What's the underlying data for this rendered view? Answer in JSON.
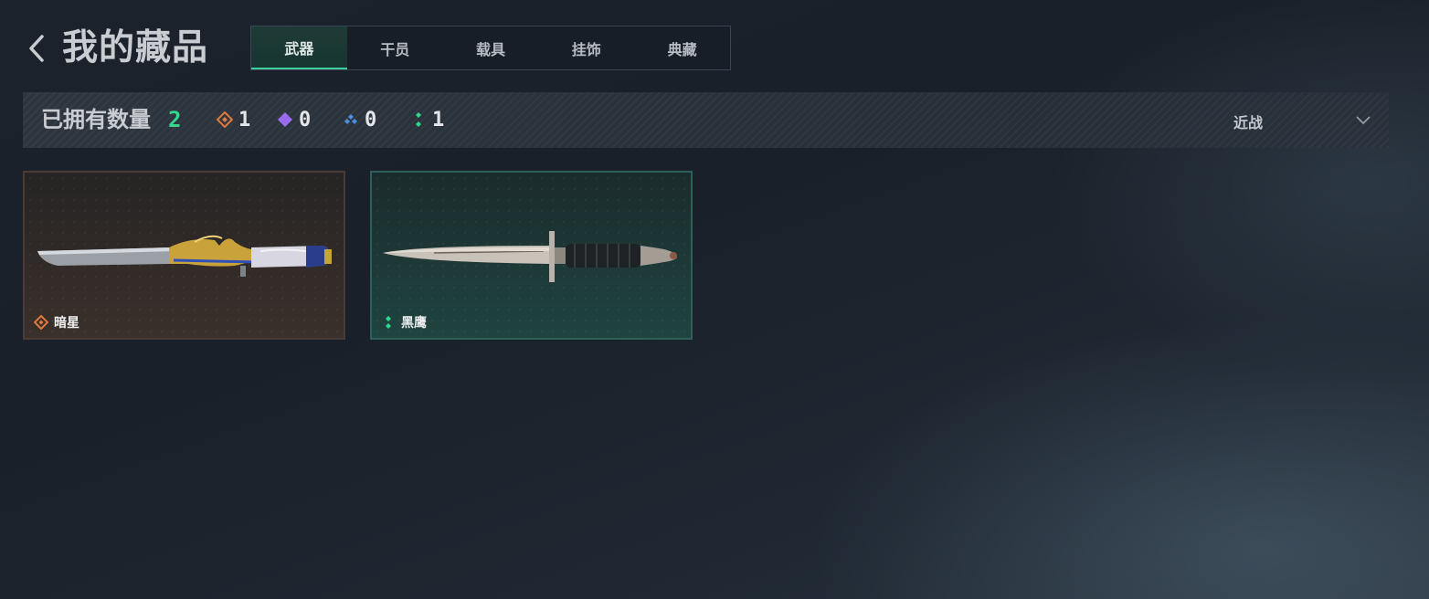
{
  "header": {
    "title": "我的藏品"
  },
  "tabs": [
    {
      "label": "武器",
      "active": true
    },
    {
      "label": "干员",
      "active": false
    },
    {
      "label": "载具",
      "active": false
    },
    {
      "label": "挂饰",
      "active": false
    },
    {
      "label": "典藏",
      "active": false
    }
  ],
  "summary": {
    "label": "已拥有数量",
    "total": "2",
    "rarities": [
      {
        "icon": "orange-diamond-icon",
        "color": "#e07a3c",
        "count": "1"
      },
      {
        "icon": "purple-diamond-icon",
        "color": "#9b6cf0",
        "count": "0"
      },
      {
        "icon": "blue-diamond-icon",
        "color": "#4a8fe0",
        "count": "0"
      },
      {
        "icon": "green-dots-icon",
        "color": "#35d58f",
        "count": "1"
      }
    ],
    "filter": {
      "selected": "近战",
      "icon": "chevron-down-icon"
    }
  },
  "items": [
    {
      "name": "暗星",
      "rarity_color": "#e07a3c",
      "rarity_icon": "orange-diamond-icon",
      "art": "ornate-knife-image"
    },
    {
      "name": "黑鹰",
      "rarity_color": "#35d58f",
      "rarity_icon": "green-dots-icon",
      "art": "combat-knife-image"
    }
  ]
}
